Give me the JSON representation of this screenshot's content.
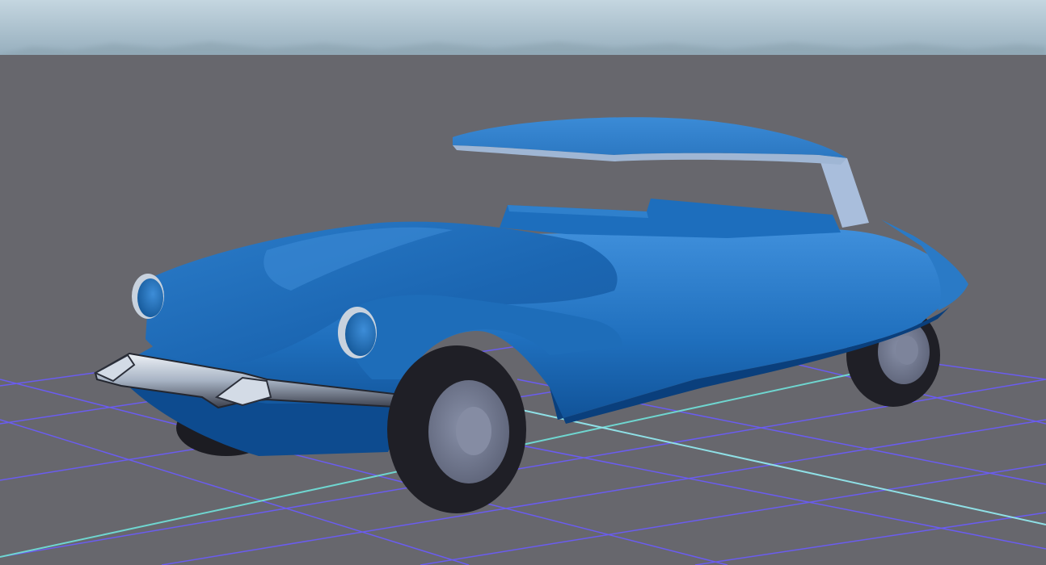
{
  "scene": {
    "view": "3d-viewport",
    "object": "convertible-car-model",
    "colors": {
      "sky_top": "#b9cfdb",
      "sky_bottom": "#94aebc",
      "ground": "#67676d",
      "grid_line": "#6a5cf0",
      "axis_x": "#6fd6d0",
      "axis_z": "#8fe0e6",
      "car_body": "#1f6fbd",
      "car_body_dark": "#0d4f94",
      "car_body_light": "#3d8ad6",
      "chrome": "#c9d4e2",
      "tire": "#1f1f26",
      "hubcap": "#737a93"
    },
    "icons": [
      "car-model"
    ]
  }
}
